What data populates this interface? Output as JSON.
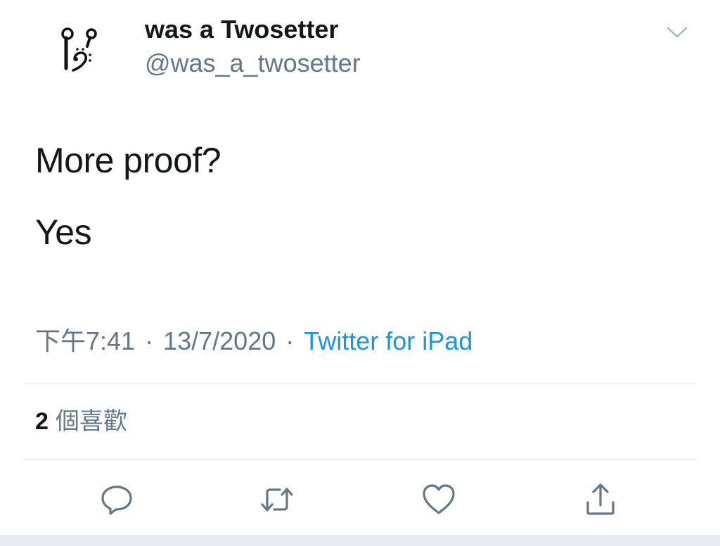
{
  "author": {
    "display_name": "was a Twosetter",
    "handle": "@was_a_twosetter",
    "avatar_icon": "musical-earbuds-avatar"
  },
  "tweet": {
    "lines": [
      "More proof?",
      "Yes"
    ]
  },
  "meta": {
    "time": "下午7:41",
    "separator": "·",
    "date": "13/7/2020",
    "source": "Twitter for iPad"
  },
  "stats": {
    "likes_count": "2",
    "likes_label": "個喜歡"
  },
  "actions": {
    "reply_icon": "reply-icon",
    "retweet_icon": "retweet-icon",
    "like_icon": "heart-icon",
    "share_icon": "share-icon"
  },
  "colors": {
    "text_primary": "#14171a",
    "text_secondary": "#657786",
    "link": "#1b95e0",
    "divider": "#e1e8ed"
  }
}
